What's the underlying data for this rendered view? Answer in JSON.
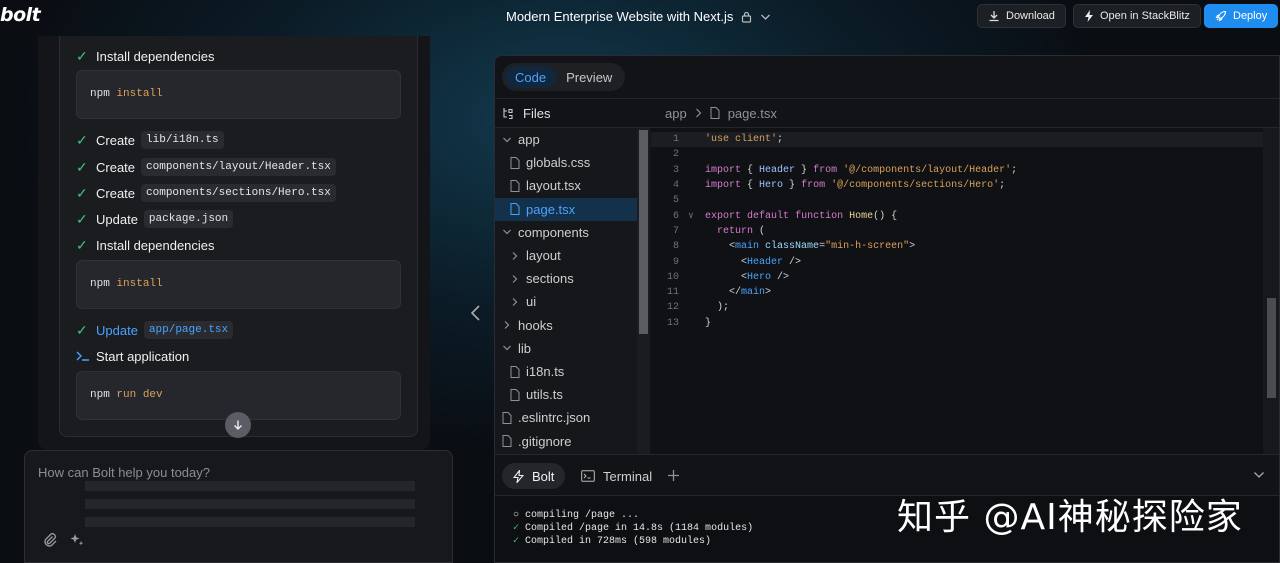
{
  "header": {
    "logo": "bolt",
    "project_title": "Modern Enterprise Website with Next.js",
    "download_label": "Download",
    "stackblitz_label": "Open in StackBlitz",
    "deploy_label": "Deploy"
  },
  "chat": {
    "steps": [
      {
        "action": "Install dependencies"
      },
      {
        "action": "Create",
        "chip": "lib/i18n.ts"
      },
      {
        "action": "Create",
        "chip": "components/layout/Header.tsx"
      },
      {
        "action": "Create",
        "chip": "components/sections/Hero.tsx"
      },
      {
        "action": "Update",
        "chip": "package.json"
      },
      {
        "action": "Install dependencies"
      },
      {
        "action": "Update",
        "chip": "app/page.tsx"
      },
      {
        "action": "Start application"
      }
    ],
    "commands": [
      {
        "cmd": "npm",
        "arg": "install"
      },
      {
        "cmd": "npm",
        "arg": "install"
      },
      {
        "cmd": "npm",
        "arg": "run dev"
      }
    ],
    "prompt_placeholder": "How can Bolt help you today?"
  },
  "workbench": {
    "tabs": [
      "Code",
      "Preview"
    ],
    "active_tab": "Code",
    "files_label": "Files",
    "breadcrumb": [
      "app",
      "page.tsx"
    ],
    "tree": [
      {
        "name": "app",
        "type": "folder-open",
        "depth": 0
      },
      {
        "name": "globals.css",
        "type": "file",
        "depth": 1
      },
      {
        "name": "layout.tsx",
        "type": "file",
        "depth": 1
      },
      {
        "name": "page.tsx",
        "type": "file",
        "depth": 1,
        "selected": true
      },
      {
        "name": "components",
        "type": "folder-open",
        "depth": 0
      },
      {
        "name": "layout",
        "type": "folder",
        "depth": 1
      },
      {
        "name": "sections",
        "type": "folder",
        "depth": 1
      },
      {
        "name": "ui",
        "type": "folder",
        "depth": 1
      },
      {
        "name": "hooks",
        "type": "folder",
        "depth": 0
      },
      {
        "name": "lib",
        "type": "folder-open",
        "depth": 0
      },
      {
        "name": "i18n.ts",
        "type": "file",
        "depth": 1
      },
      {
        "name": "utils.ts",
        "type": "file",
        "depth": 1
      },
      {
        "name": ".eslintrc.json",
        "type": "file",
        "depth": 0
      },
      {
        "name": ".gitignore",
        "type": "file",
        "depth": 0
      }
    ],
    "code_lines": [
      [
        {
          "t": "'use client'",
          "c": "str"
        },
        {
          "t": ";",
          "c": "pn"
        }
      ],
      [],
      [
        {
          "t": "import",
          "c": "kw"
        },
        {
          "t": " { ",
          "c": "pn"
        },
        {
          "t": "Header",
          "c": "id"
        },
        {
          "t": " } ",
          "c": "pn"
        },
        {
          "t": "from",
          "c": "kw"
        },
        {
          "t": " ",
          "c": "pn"
        },
        {
          "t": "'@/components/layout/Header'",
          "c": "str"
        },
        {
          "t": ";",
          "c": "pn"
        }
      ],
      [
        {
          "t": "import",
          "c": "kw"
        },
        {
          "t": " { ",
          "c": "pn"
        },
        {
          "t": "Hero",
          "c": "id"
        },
        {
          "t": " } ",
          "c": "pn"
        },
        {
          "t": "from",
          "c": "kw"
        },
        {
          "t": " ",
          "c": "pn"
        },
        {
          "t": "'@/components/sections/Hero'",
          "c": "str"
        },
        {
          "t": ";",
          "c": "pn"
        }
      ],
      [],
      [
        {
          "t": "export",
          "c": "kw"
        },
        {
          "t": " ",
          "c": "pn"
        },
        {
          "t": "default",
          "c": "kw"
        },
        {
          "t": " ",
          "c": "pn"
        },
        {
          "t": "function",
          "c": "kw"
        },
        {
          "t": " ",
          "c": "pn"
        },
        {
          "t": "Home",
          "c": "fn"
        },
        {
          "t": "() {",
          "c": "pn"
        }
      ],
      [
        {
          "t": "  ",
          "c": "pn"
        },
        {
          "t": "return",
          "c": "kw"
        },
        {
          "t": " (",
          "c": "pn"
        }
      ],
      [
        {
          "t": "    <",
          "c": "pn"
        },
        {
          "t": "main",
          "c": "tg"
        },
        {
          "t": " ",
          "c": "pn"
        },
        {
          "t": "className",
          "c": "at"
        },
        {
          "t": "=",
          "c": "pn"
        },
        {
          "t": "\"min-h-screen\"",
          "c": "str"
        },
        {
          "t": ">",
          "c": "pn"
        }
      ],
      [
        {
          "t": "      <",
          "c": "pn"
        },
        {
          "t": "Header",
          "c": "tg"
        },
        {
          "t": " />",
          "c": "pn"
        }
      ],
      [
        {
          "t": "      <",
          "c": "pn"
        },
        {
          "t": "Hero",
          "c": "tg"
        },
        {
          "t": " />",
          "c": "pn"
        }
      ],
      [
        {
          "t": "    </",
          "c": "pn"
        },
        {
          "t": "main",
          "c": "tg"
        },
        {
          "t": ">",
          "c": "pn"
        }
      ],
      [
        {
          "t": "  );",
          "c": "pn"
        }
      ],
      [
        {
          "t": "}",
          "c": "pn"
        }
      ]
    ],
    "line_numbers": [
      "1",
      "2",
      "3",
      "4",
      "5",
      "6",
      "7",
      "8",
      "9",
      "10",
      "11",
      "12",
      "13"
    ],
    "terminal_tabs": [
      "Bolt",
      "Terminal"
    ],
    "terminal_lines": [
      {
        "mark": "○",
        "text": " compiling /page ..."
      },
      {
        "mark": "✓",
        "text": " Compiled /page in 14.8s (1184 modules)"
      },
      {
        "mark": "✓",
        "text": " Compiled in 728ms (598 modules)"
      }
    ]
  },
  "watermark": "知乎 @AI神秘探险家",
  "colors": {
    "accent": "#1f8cf0",
    "success": "#3fc27a",
    "link": "#4aa3ff"
  }
}
